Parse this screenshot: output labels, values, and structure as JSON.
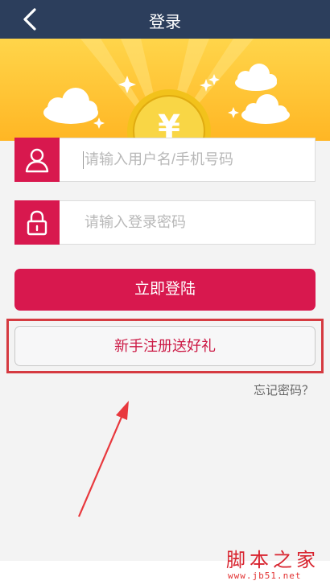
{
  "header": {
    "title": "登录",
    "back_icon": "chevron-left-icon"
  },
  "banner": {
    "coin_symbol": "¥"
  },
  "form": {
    "username": {
      "placeholder": "请输入用户名/手机号码",
      "value": "",
      "icon": "user-icon"
    },
    "password": {
      "placeholder": "请输入登录密码",
      "value": "",
      "icon": "lock-icon"
    },
    "login_label": "立即登陆",
    "register_label": "新手注册送好礼",
    "forgot_label": "忘记密码？"
  },
  "watermark": {
    "site_name": "脚本之家",
    "url": "www.jb51.net"
  },
  "colors": {
    "header_bg": "#2c3e5c",
    "accent": "#d8184e",
    "banner_yellow": "#ffc233",
    "highlight_red": "#d53a40"
  }
}
